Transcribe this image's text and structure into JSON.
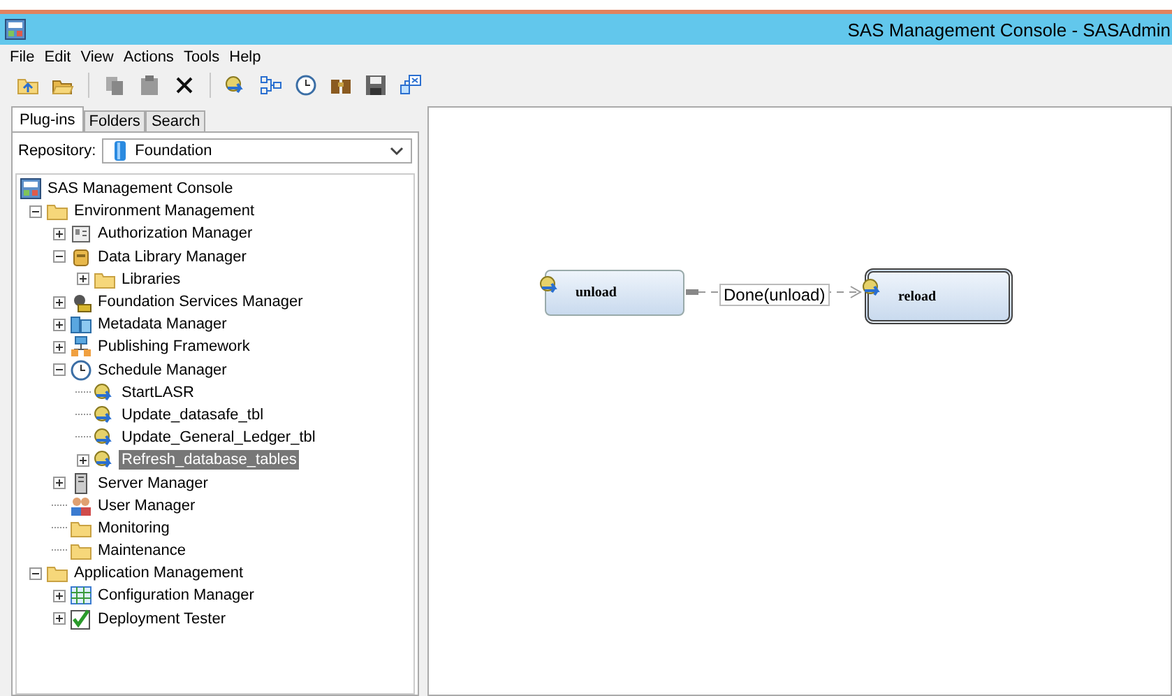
{
  "window": {
    "title": "SAS Management Console - SASAdmin"
  },
  "menu": [
    "File",
    "Edit",
    "View",
    "Actions",
    "Tools",
    "Help"
  ],
  "tabs": [
    {
      "label": "Plug-ins",
      "selected": true
    },
    {
      "label": "Folders",
      "selected": false
    },
    {
      "label": "Search",
      "selected": false
    }
  ],
  "repository": {
    "label": "Repository:",
    "value": "Foundation"
  },
  "tree": [
    {
      "label": "SAS Management Console",
      "kind": "root",
      "selected": false,
      "children": [
        {
          "label": "Environment Management",
          "kind": "folder",
          "expanded": true,
          "selected": false,
          "children": [
            {
              "label": "Authorization Manager",
              "kind": "auth",
              "expanded": false,
              "selected": false
            },
            {
              "label": "Data Library Manager",
              "kind": "library",
              "expanded": true,
              "selected": false,
              "children": [
                {
                  "label": "Libraries",
                  "kind": "folder",
                  "expanded": false,
                  "selected": false
                }
              ]
            },
            {
              "label": "Foundation Services Manager",
              "kind": "services",
              "expanded": false,
              "selected": false
            },
            {
              "label": "Metadata Manager",
              "kind": "metadata",
              "expanded": false,
              "selected": false
            },
            {
              "label": "Publishing Framework",
              "kind": "publish",
              "expanded": false,
              "selected": false
            },
            {
              "label": "Schedule Manager",
              "kind": "clock",
              "expanded": true,
              "selected": false,
              "children": [
                {
                  "label": "StartLASR",
                  "kind": "job",
                  "selected": false
                },
                {
                  "label": "Update_datasafe_tbl",
                  "kind": "job",
                  "selected": false
                },
                {
                  "label": "Update_General_Ledger_tbl",
                  "kind": "job",
                  "selected": false
                },
                {
                  "label": "Refresh_database_tables",
                  "kind": "job",
                  "expanded": false,
                  "selected": true
                }
              ]
            },
            {
              "label": "Server Manager",
              "kind": "server",
              "expanded": false,
              "selected": false
            },
            {
              "label": "User Manager",
              "kind": "users",
              "selected": false
            },
            {
              "label": "Monitoring",
              "kind": "folder",
              "selected": false
            },
            {
              "label": "Maintenance",
              "kind": "folder",
              "selected": false
            }
          ]
        },
        {
          "label": "Application Management",
          "kind": "folder",
          "expanded": true,
          "selected": false,
          "children": [
            {
              "label": "Configuration Manager",
              "kind": "config",
              "expanded": false,
              "selected": false
            },
            {
              "label": "Deployment Tester",
              "kind": "check",
              "expanded": false,
              "selected": false
            }
          ]
        }
      ]
    }
  ],
  "flow": {
    "nodes": [
      {
        "label": "unload",
        "selected": false
      },
      {
        "label": "reload",
        "selected": true
      }
    ],
    "connector": {
      "label": "Done(unload)"
    }
  }
}
